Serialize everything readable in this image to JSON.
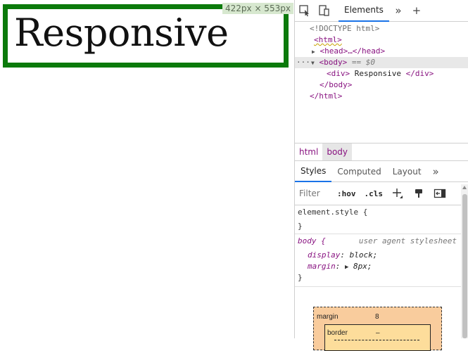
{
  "viewport": {
    "demo_text": "Responsive",
    "dimensions_badge": "422px × 553px",
    "box_border_color": "#0b7a0b"
  },
  "devtools": {
    "toolbar": {
      "inspect_icon": "inspect-element-icon",
      "device_icon": "device-toolbar-icon",
      "active_tab": "Elements",
      "more_tabs_icon": "chevrons-right-icon",
      "add_tab_icon": "plus-icon"
    },
    "dom": {
      "doctype": "<!DOCTYPE html>",
      "html_open": "<html>",
      "head_collapsed": "<head>…</head>",
      "ellipsis": "···",
      "body_open": "<body>",
      "body_marker": "== $0",
      "div_open": "<div>",
      "div_text": " Responsive ",
      "div_close": "</div>",
      "body_close": "</body>",
      "html_close": "</html>"
    },
    "breadcrumbs": [
      "html",
      "body"
    ],
    "subtabs": [
      "Styles",
      "Computed",
      "Layout"
    ],
    "subtabs_more_icon": "chevrons-right-icon",
    "filter": {
      "placeholder": "Filter",
      "hov": ":hov",
      "cls": ".cls",
      "new_rule_icon": "plus-icon",
      "computed_sidebar_icon": "paint-bucket-icon",
      "toggle_sidebar_icon": "toggle-sidebar-icon"
    },
    "styles": {
      "element_style_open": "element.style {",
      "element_style_close": "}",
      "body_selector": "body {",
      "body_source": "user agent stylesheet",
      "display_prop": "display",
      "display_val": "block;",
      "margin_prop": "margin",
      "margin_val": "8px;",
      "body_close": "}"
    },
    "box_model": {
      "margin_label": "margin",
      "margin_value": "8",
      "border_label": "border",
      "border_value": "–"
    }
  }
}
